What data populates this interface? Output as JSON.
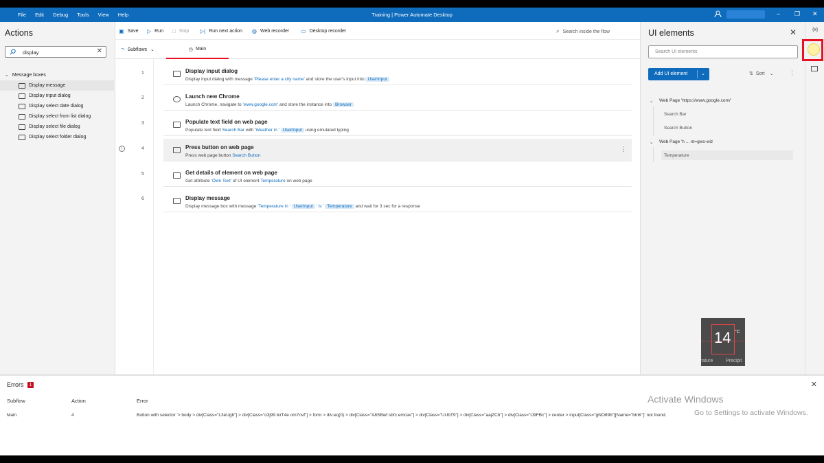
{
  "window": {
    "menu": [
      "File",
      "Edit",
      "Debug",
      "Tools",
      "View",
      "Help"
    ],
    "title": "Training | Power Automate Desktop",
    "controls": {
      "minimize": "–",
      "restore": "❐",
      "close": "✕"
    }
  },
  "actions_panel": {
    "title": "Actions",
    "search_value": "display",
    "clear_glyph": "✕",
    "group": {
      "chevron": "⌄",
      "label": "Message boxes"
    },
    "items": [
      "Display message",
      "Display input dialog",
      "Display select date dialog",
      "Display select from list dialog",
      "Display select file dialog",
      "Display select folder dialog"
    ]
  },
  "toolbar": {
    "save": "Save",
    "run": "Run",
    "stop": "Stop",
    "run_next": "Run next action",
    "web_recorder": "Web recorder",
    "desktop_recorder": "Desktop recorder",
    "search_flow": "Search inside the flow"
  },
  "tabs": {
    "subflows": "Subflows",
    "main": "Main"
  },
  "steps": [
    {
      "no": "1",
      "title": "Display input dialog",
      "d1": "Display input dialog with message ",
      "q1": "'Please enter a city name'",
      "d2": " and store the user's input into ",
      "chip1": "UserInput"
    },
    {
      "no": "2",
      "title": "Launch new Chrome",
      "d1": "Launch Chrome, navigate to ",
      "q1": "'www.google.com'",
      "d2": " and store the instance into ",
      "chip1": "Browser"
    },
    {
      "no": "3",
      "title": "Populate text field on web page",
      "d1": "Populate text field ",
      "q1": "Search Bar",
      "d2": " with ",
      "q2": "'Weather in '",
      "chip1": "UserInput",
      "d3": " using emulated typing"
    },
    {
      "no": "4",
      "title": "Press button on web page",
      "d1": "Press web page button ",
      "q1": "Search Button"
    },
    {
      "no": "5",
      "title": "Get details of element on web page",
      "d1": "Get attribute ",
      "q1": "'Own Text'",
      "d2": " of UI element ",
      "q2": "Temperature",
      "d3": " on web page"
    },
    {
      "no": "6",
      "title": "Display message",
      "d1": "Display message box with message ",
      "q1": "'Temperature in '",
      "chip1": "UserInput",
      "q2": "' is '",
      "chip2": "Temperature",
      "d3": " and wait for 3 sec for a response"
    }
  ],
  "ui_panel": {
    "title": "UI elements",
    "close": "✕",
    "search_placeholder": "Search UI elements",
    "add_button": "Add UI element",
    "sort": "Sort",
    "tree": [
      {
        "label": "Web Page 'https://www.google.com/'",
        "children": [
          "Search Bar",
          "Search Button"
        ]
      },
      {
        "label": "Web Page 'h ... nt=gws-wiz",
        "children": [
          "Temperature"
        ]
      }
    ],
    "thumb": {
      "value": "14",
      "unit": "°C",
      "left_text": "rature",
      "right_text": "Precipit"
    }
  },
  "side": {
    "variables": "{x}"
  },
  "errors": {
    "title": "Errors",
    "count": "1",
    "close": "✕",
    "columns": [
      "Subflow",
      "Action",
      "Error"
    ],
    "rows": [
      {
        "subflow": "Main",
        "action": "4",
        "error": "Button with selector '> body > div[Class=\"L3eUgb\"] > div[Class=\"o3j99 ikrT4e om7nvf\"] > form > div:eq(0) > div[Class=\"A8SBwf sbfc emcav\"] > div[Class=\"UUbT9\"] > div[Class=\"aajZCb\"] > div[Class=\"lJ9FBc\"] > center > input[Class=\"gNO89b\"][Name=\"btnK\"]' not found."
      }
    ]
  },
  "watermark": {
    "line1": "Activate Windows",
    "line2": "Go to Settings to activate Windows."
  }
}
